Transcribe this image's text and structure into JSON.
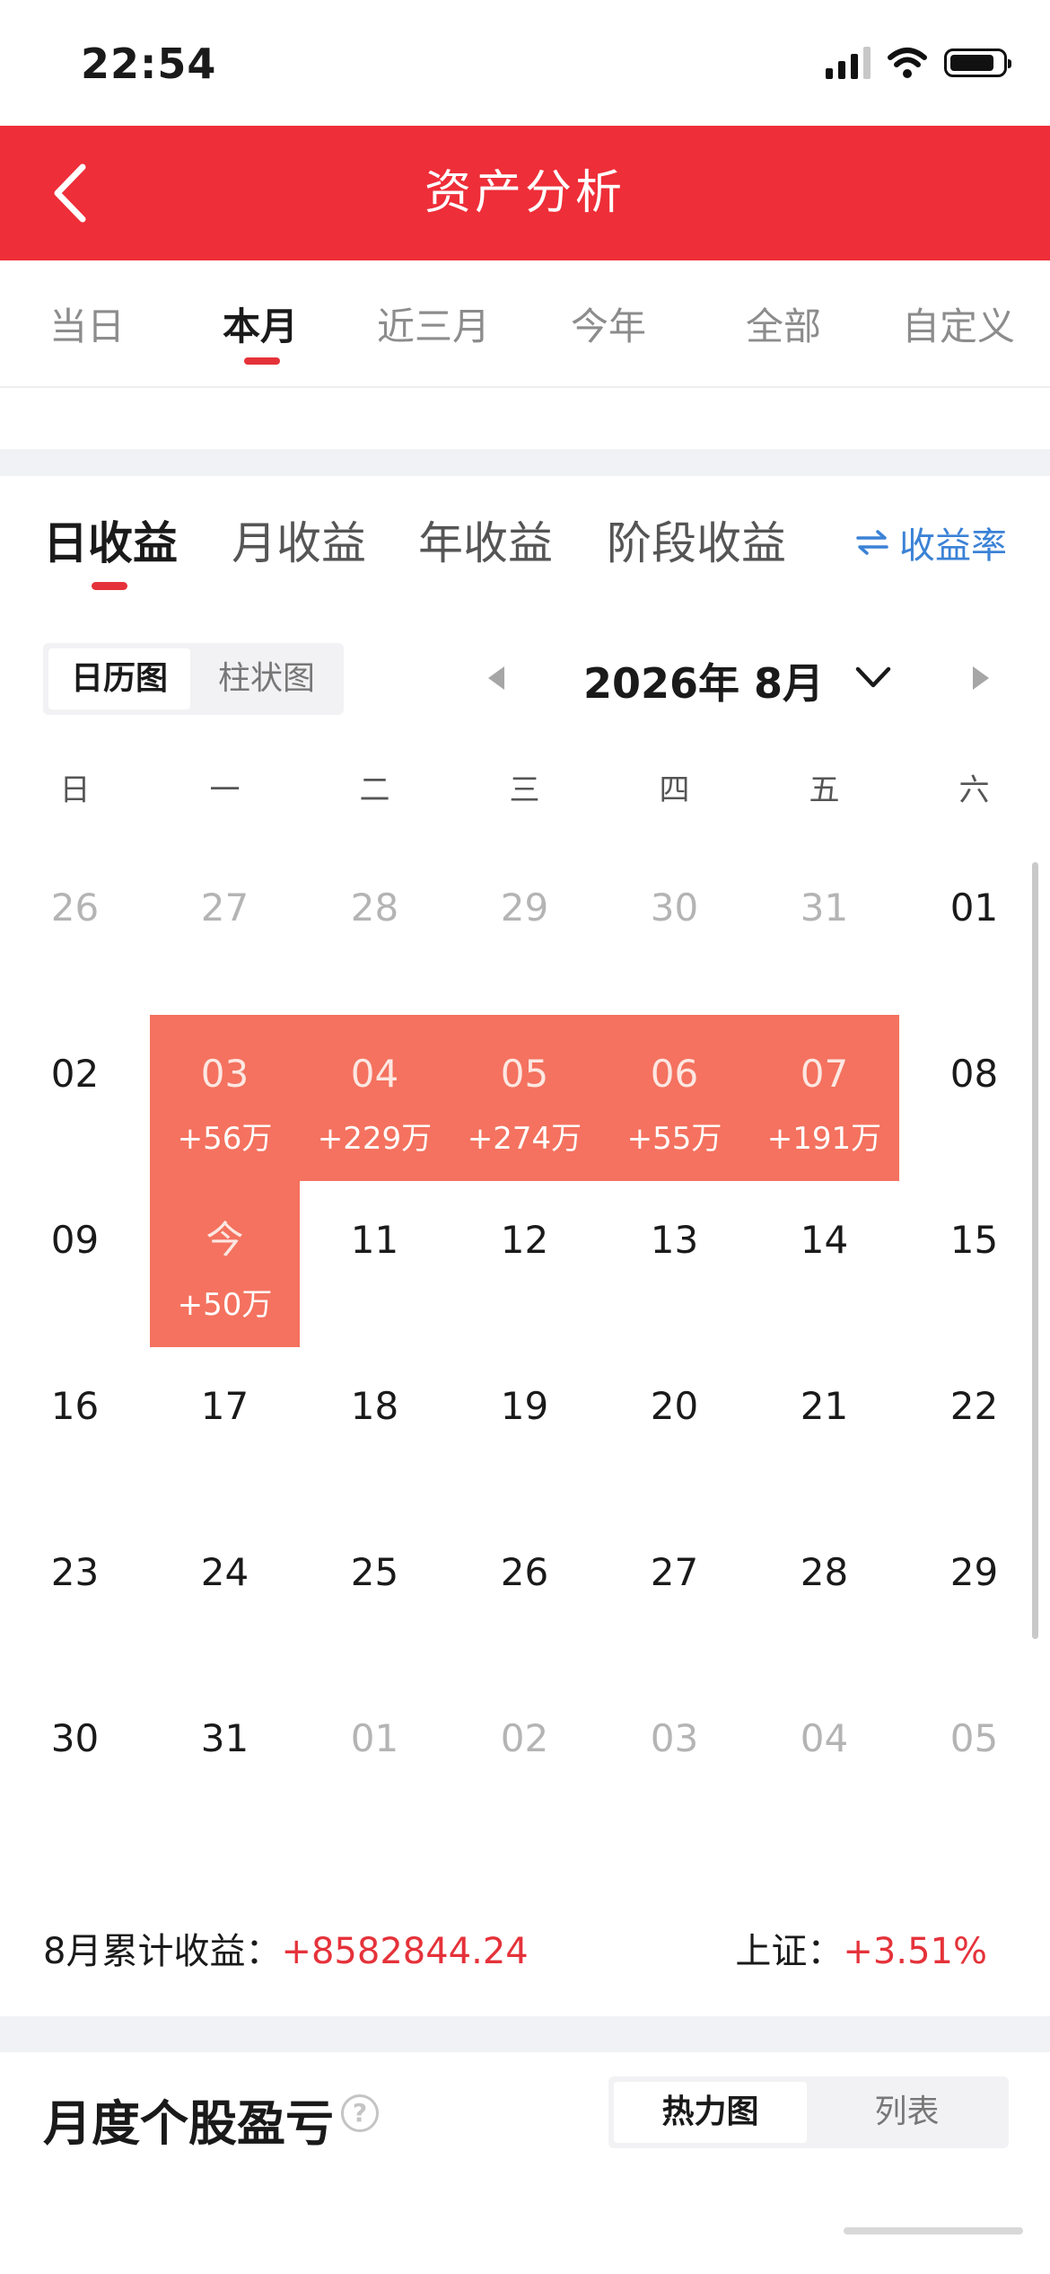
{
  "status_bar": {
    "time": "22:54"
  },
  "header": {
    "title": "资产分析"
  },
  "period_tabs": [
    {
      "label": "当日"
    },
    {
      "label": "本月"
    },
    {
      "label": "近三月"
    },
    {
      "label": "今年"
    },
    {
      "label": "全部"
    },
    {
      "label": "自定义"
    }
  ],
  "active_period": "本月",
  "earnings_tabs": [
    {
      "label": "日收益"
    },
    {
      "label": "月收益"
    },
    {
      "label": "年收益"
    },
    {
      "label": "阶段收益"
    }
  ],
  "yield_rate_label": "收益率",
  "view_toggle": {
    "calendar": "日历图",
    "bar": "柱状图"
  },
  "month_label": "2026年 8月",
  "weekdays": [
    "日",
    "一",
    "二",
    "三",
    "四",
    "五",
    "六"
  ],
  "calendar": [
    [
      {
        "d": "26",
        "m": true
      },
      {
        "d": "27",
        "m": true
      },
      {
        "d": "28",
        "m": true
      },
      {
        "d": "29",
        "m": true
      },
      {
        "d": "30",
        "m": true
      },
      {
        "d": "31",
        "m": true
      },
      {
        "d": "01"
      }
    ],
    [
      {
        "d": "02"
      },
      {
        "d": "03",
        "v": "+56万"
      },
      {
        "d": "04",
        "v": "+229万"
      },
      {
        "d": "05",
        "v": "+274万"
      },
      {
        "d": "06",
        "v": "+55万"
      },
      {
        "d": "07",
        "v": "+191万"
      },
      {
        "d": "08"
      }
    ],
    [
      {
        "d": "09"
      },
      {
        "d": "今",
        "v": "+50万"
      },
      {
        "d": "11"
      },
      {
        "d": "12"
      },
      {
        "d": "13"
      },
      {
        "d": "14"
      },
      {
        "d": "15"
      }
    ],
    [
      {
        "d": "16"
      },
      {
        "d": "17"
      },
      {
        "d": "18"
      },
      {
        "d": "19"
      },
      {
        "d": "20"
      },
      {
        "d": "21"
      },
      {
        "d": "22"
      }
    ],
    [
      {
        "d": "23"
      },
      {
        "d": "24"
      },
      {
        "d": "25"
      },
      {
        "d": "26"
      },
      {
        "d": "27"
      },
      {
        "d": "28"
      },
      {
        "d": "29"
      }
    ],
    [
      {
        "d": "30"
      },
      {
        "d": "31"
      },
      {
        "d": "01",
        "m": true
      },
      {
        "d": "02",
        "m": true
      },
      {
        "d": "03",
        "m": true
      },
      {
        "d": "04",
        "m": true
      },
      {
        "d": "05",
        "m": true
      }
    ]
  ],
  "summary": {
    "month_label": "8月累计收益：",
    "month_value": "+8582844.24",
    "index_label": "上证：",
    "index_value": "+3.51%"
  },
  "monthly_section": {
    "title": "月度个股盈亏",
    "help": "?",
    "toggle": {
      "heatmap": "热力图",
      "list": "列表"
    }
  },
  "colors": {
    "brand_red": "#ee2e38",
    "gain_cell": "#f4725f",
    "link_blue": "#3b82d6"
  }
}
